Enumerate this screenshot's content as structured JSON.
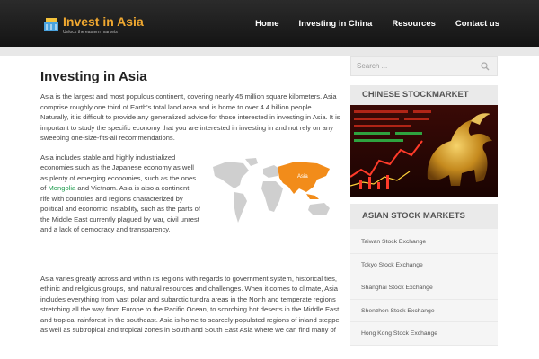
{
  "site": {
    "title": "Invest in Asia",
    "tagline": "Unlock the eastern markets"
  },
  "nav": {
    "items": [
      "Home",
      "Investing in China",
      "Resources",
      "Contact us"
    ]
  },
  "article": {
    "title": "Investing in Asia",
    "p1": "Asia is the largest and most populous continent, covering nearly 45 million square kilometers. Asia comprise roughly one third of Earth's total land area and is home to over 4.4 billion people. Naturally, it is difficult to provide any generalized advice for those interested in investing in Asia. It is important to study the specific economy that you are interested in investing in and not rely on any sweeping one-size-fits-all recommendations.",
    "p2_before": "Asia includes stable and highly industrialized economies such as the Japanese economy as well as plenty of emerging economies, such as the ones of ",
    "p2_link": "Mongolia",
    "p2_after": " and Vietnam. Asia is also a continent rife with countries and regions characterized by political and economic instability, such as the parts of the Middle East currently plagued by war, civil unrest and a lack of democracy and transparency.",
    "map_label": "Asia",
    "p3": "Asia varies greatly across and within its regions with regards to government system, historical ties, ethinic and religious groups, and natural resources and challenges. When it comes to climate, Asia includes everything from vast polar and subarctic tundra areas in the North and temperate regions stretching all the way from Europe to the Pacific Ocean, to scorching hot deserts in the Middle East and tropical rainforest in the southeast. Asia is home to scarcely populated regions of inland steppe as well as subtropical and tropical zones in South and South East Asia where we can find many of"
  },
  "sidebar": {
    "search_placeholder": "Search ...",
    "widget1_title": "Chinese Stockmarket",
    "widget2_title": "Asian Stock Markets",
    "markets": [
      "Taiwan Stock Exchange",
      "Tokyo Stock Exchange",
      "Shanghai Stock Exchange",
      "Shenzhen Stock Exchange",
      "Hong Kong Stock Exchange"
    ]
  },
  "colors": {
    "accent": "#f0a830",
    "link": "#1f9c4e",
    "header_bg": "#1c1c1c",
    "map_highlight": "#f28c1a"
  }
}
